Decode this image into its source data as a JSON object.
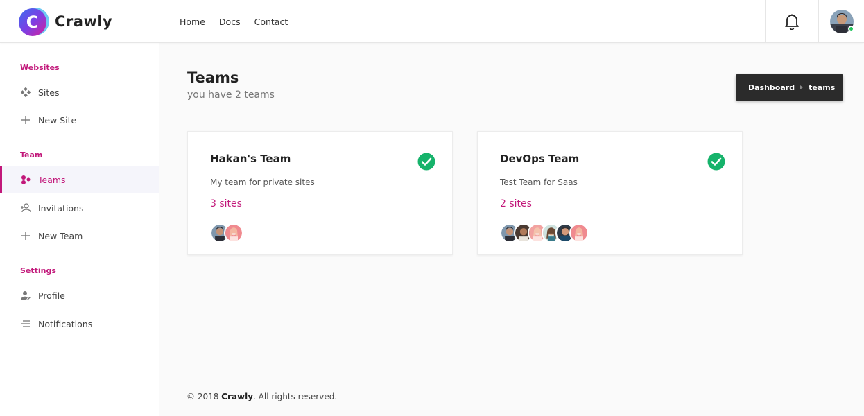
{
  "brand": {
    "name": "Crawly",
    "logo_letter": "C"
  },
  "topnav": {
    "items": [
      "Home",
      "Docs",
      "Contact"
    ]
  },
  "sidebar": {
    "sections": [
      {
        "title": "Websites",
        "items": [
          {
            "label": "Sites",
            "icon": "sites-icon"
          },
          {
            "label": "New Site",
            "icon": "plus-icon"
          }
        ]
      },
      {
        "title": "Team",
        "items": [
          {
            "label": "Teams",
            "icon": "teams-icon",
            "active": true
          },
          {
            "label": "Invitations",
            "icon": "invite-icon"
          },
          {
            "label": "New Team",
            "icon": "plus-icon"
          }
        ]
      },
      {
        "title": "Settings",
        "items": [
          {
            "label": "Profile",
            "icon": "profile-icon"
          },
          {
            "label": "Notifications",
            "icon": "notifications-icon"
          }
        ]
      }
    ]
  },
  "page": {
    "title": "Teams",
    "subtitle": "you have 2 teams"
  },
  "breadcrumb": {
    "items": [
      "Dashboard",
      "teams"
    ]
  },
  "teams": [
    {
      "name": "Hakan's Team",
      "description": "My team for private sites",
      "sites": "3 sites",
      "member_count": 2
    },
    {
      "name": "DevOps Team",
      "description": "Test Team for Saas",
      "sites": "2 sites",
      "member_count": 6
    }
  ],
  "footer": {
    "prefix": "© 2018 ",
    "brand": "Crawly",
    "suffix": ". All rights reserved."
  },
  "colors": {
    "accent": "#c2187a",
    "check": "#16b36b",
    "breadcrumb_bg": "#2b2b2b"
  }
}
